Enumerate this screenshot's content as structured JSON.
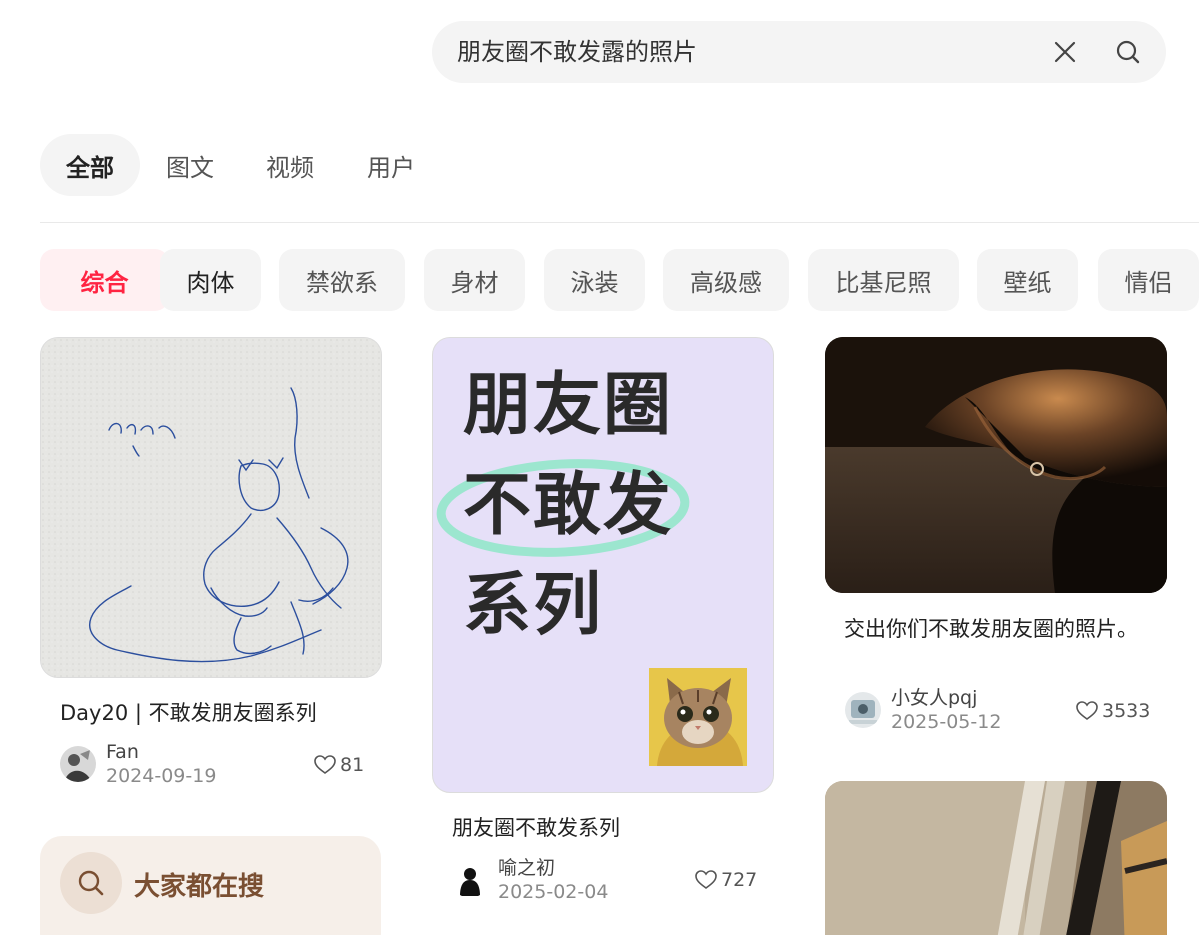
{
  "search": {
    "query": "朋友圈不敢发露的照片"
  },
  "tabs": [
    "全部",
    "图文",
    "视频",
    "用户"
  ],
  "chips": [
    "综合",
    "肉体",
    "禁欲系",
    "身材",
    "泳装",
    "高级感",
    "比基尼照",
    "壁纸",
    "情侣"
  ],
  "cards": [
    {
      "title": "Day20 | 不敢发朋友圈系列",
      "author": "Fan",
      "date": "2024-09-19",
      "likes": "81"
    },
    {
      "title": "朋友圈不敢发系列",
      "author": "喻之初",
      "date": "2025-02-04",
      "likes": "727",
      "cover_lines": [
        "朋友圈",
        "不敢发",
        "系列"
      ]
    },
    {
      "title": "交出你们不敢发朋友圈的照片。",
      "author": "小女人pqj",
      "date": "2025-05-12",
      "likes": "3533"
    }
  ],
  "promo": {
    "label": "大家都在搜"
  },
  "colors": {
    "accent": "#ff2442",
    "chip_bg": "#f4f4f4",
    "promo_bg": "#f6efe9",
    "cover_bg": "#e6e0f8"
  }
}
